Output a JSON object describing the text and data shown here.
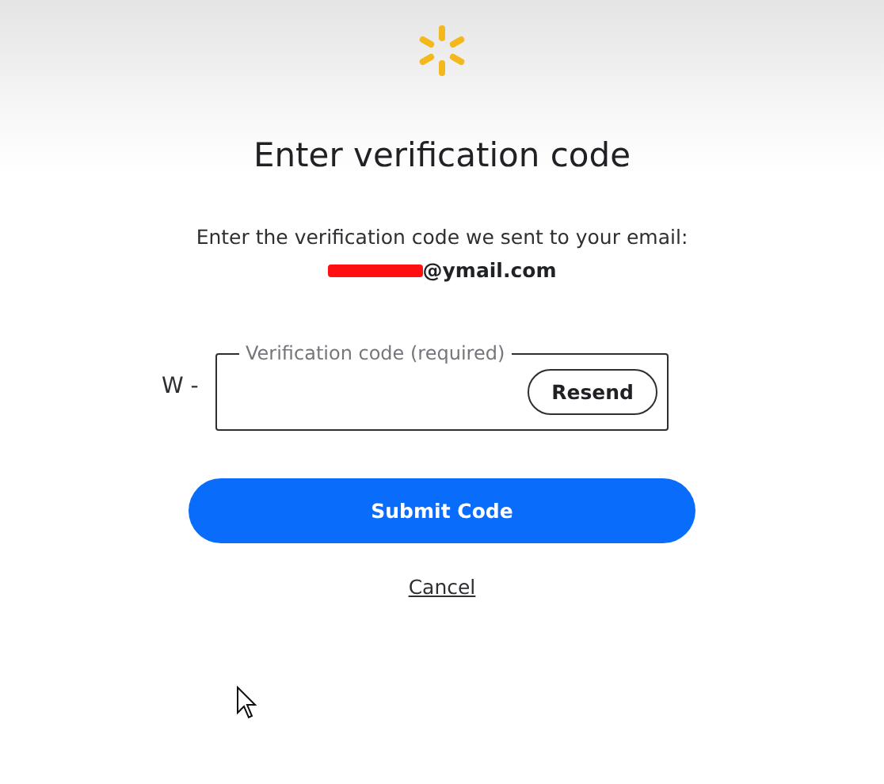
{
  "title": "Enter verification code",
  "message": "Enter the verification code we sent to your email:",
  "email": "@ymail.com",
  "code_field": {
    "prefix": "W -",
    "label": "Verification code (required)",
    "resend_button": "Resend"
  },
  "submit_button": "Submit Code",
  "cancel_link": "Cancel"
}
